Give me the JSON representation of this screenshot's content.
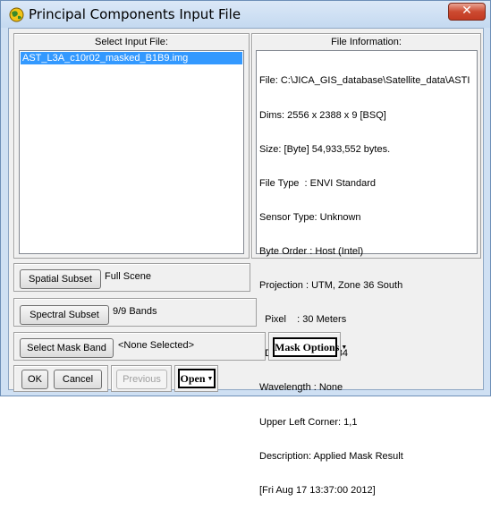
{
  "window": {
    "title": "Principal Components Input File",
    "close_glyph": "✕"
  },
  "input_panel": {
    "header": "Select Input File:",
    "files": [
      "AST_L3A_c10r02_masked_B1B9.img"
    ]
  },
  "info_panel": {
    "header": "File Information:",
    "lines": [
      "File: C:\\JICA_GIS_database\\Satellite_data\\ASTI",
      "Dims: 2556 x 2388 x 9 [BSQ]",
      "Size: [Byte] 54,933,552 bytes.",
      "File Type  : ENVI Standard",
      "Sensor Type: Unknown",
      "Byte Order : Host (Intel)",
      "Projection : UTM, Zone 36 South",
      "  Pixel    : 30 Meters",
      "  Datum    : WGS-84",
      "Wavelength : None",
      "Upper Left Corner: 1,1",
      "Description: Applied Mask Result",
      "[Fri Aug 17 13:37:00 2012]"
    ]
  },
  "spatial": {
    "button": "Spatial Subset",
    "value": "Full Scene"
  },
  "spectral": {
    "button": "Spectral Subset",
    "value": "9/9 Bands"
  },
  "mask": {
    "button": "Select Mask Band",
    "value": "<None Selected>",
    "options_button": "Mask Options"
  },
  "footer": {
    "ok": "OK",
    "cancel": "Cancel",
    "previous": "Previous",
    "open": "Open"
  },
  "icons": {
    "app": "envi-globe-icon",
    "dropdown": "dropdown-arrow-icon"
  }
}
